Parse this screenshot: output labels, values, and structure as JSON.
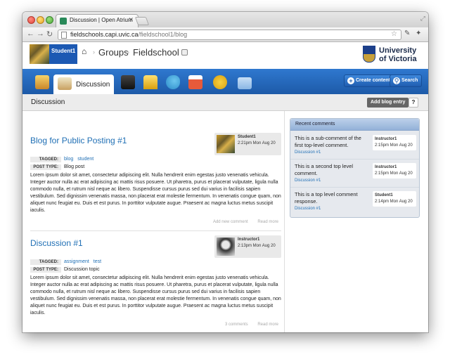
{
  "browser": {
    "tab_title": "Discussion | Open Atrium",
    "url_host": "fieldschools.capi.uvic.ca",
    "url_path": "/fieldschool1/blog"
  },
  "header": {
    "user_name": "Student1",
    "breadcrumb": [
      "Groups",
      "Fieldschool 1"
    ],
    "university_line1": "University",
    "university_line2": "of Victoria"
  },
  "navbar": {
    "active_label": "Discussion",
    "create_label": "Create content",
    "search_label": "Search"
  },
  "subbar": {
    "title": "Discussion",
    "add_label": "Add blog entry",
    "help_label": "?"
  },
  "labels": {
    "tagged": "TAGGED:",
    "post_type": "POST TYPE:"
  },
  "posts": [
    {
      "title": "Blog for Public Posting #1",
      "author": "Student1",
      "time": "2:21pm Mon Aug 20",
      "tags": [
        "blog",
        "student"
      ],
      "type": "Blog post",
      "body": "Lorem ipsum dolor sit amet, consectetur adipiscing elit. Nulla hendrerit enim egestas justo venenatis vehicula. Integer auctor nulla ac erat adipiscing ac mattis risus posuere. Ut pharetra, purus et placerat vulputate, ligula nulla commodo nulla, et rutrum nisl neque ac libero. Suspendisse cursus purus sed dui varius in facilisis sapien vestibulum. Sed dignissim venenatis massa, non placerat erat molestie fermentum. In venenatis congue quam, non aliquet nunc feugiat eu. Duis et est purus. In porttitor vulputate augue. Praesent ac magna luctus metus suscipit iaculis.",
      "link1": "Add new comment",
      "link2": "Read more"
    },
    {
      "title": "Discussion #1",
      "author": "Instructor1",
      "time": "2:13pm Mon Aug 20",
      "tags": [
        "assignment",
        "test"
      ],
      "type": "Discussion topic",
      "body": "Lorem ipsum dolor sit amet, consectetur adipiscing elit. Nulla hendrerit enim egestas justo venenatis vehicula. Integer auctor nulla ac erat adipiscing ac mattis risus posuere. Ut pharetra, purus et placerat vulputate, ligula nulla commodo nulla, et rutrum nisl neque ac libero. Suspendisse cursus purus sed dui varius in facilisis sapien vestibulum. Sed dignissim venenatis massa, non placerat erat molestie fermentum. In venenatis congue quam, non aliquet nunc feugiat eu. Duis et est purus. In porttitor vulputate augue. Praesent ac magna luctus metus suscipit iaculis.",
      "link1": "3 comments",
      "link2": "Read more"
    }
  ],
  "sidebar": {
    "title": "Recent comments",
    "comments": [
      {
        "text": "This is a sub-comment of the first top-level comment.",
        "link": "Discussion #1",
        "author": "Instructor1",
        "time": "2:15pm Mon Aug 20"
      },
      {
        "text": "This is a second top level comment.",
        "link": "Discussion #1",
        "author": "Instructor1",
        "time": "2:15pm Mon Aug 20"
      },
      {
        "text": "This is a top level comment response.",
        "link": "Discussion #1",
        "author": "Student1",
        "time": "2:14pm Mon Aug 20"
      }
    ]
  },
  "colors": {
    "nav_blue": "#1d5aa8",
    "link_blue": "#2170b5"
  }
}
